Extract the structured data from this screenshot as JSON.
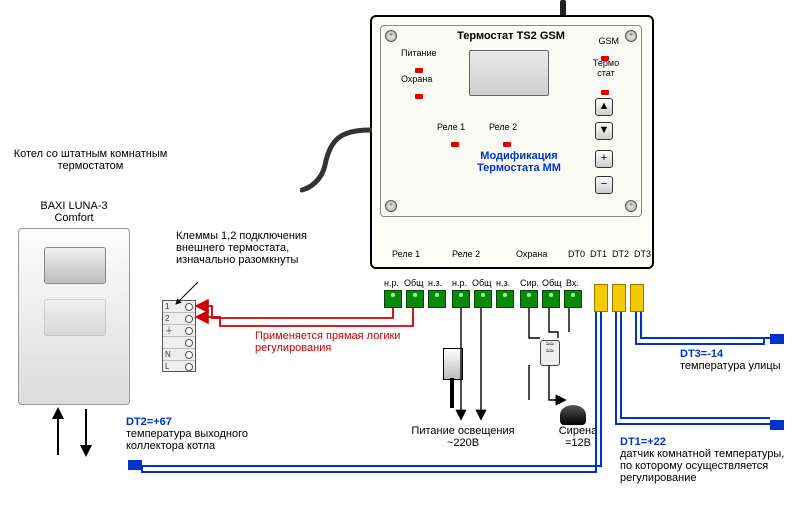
{
  "boiler": {
    "header": "Котел со штатным комнатным термостатом",
    "model": "BAXI LUNA-3 Comfort"
  },
  "terminals_note": "Клеммы 1,2 подключения внешнего термостата, изначально разомкнуты",
  "terminals": {
    "rows": [
      "1",
      "2",
      "⏚",
      "",
      "N",
      "L"
    ]
  },
  "logic_note": "Применяется прямая логики регулирования",
  "device": {
    "title": "Термостат TS2 GSM",
    "modification": "Модификация Термостата  MM",
    "labels": {
      "power": "Питание",
      "guard": "Охрана",
      "gsm": "GSM",
      "thermo_small": "Термо стат",
      "relay1": "Реле 1",
      "relay2": "Реле 2"
    },
    "buttons": {
      "up": "▲",
      "down": "▼",
      "plus": "+",
      "minus": "−"
    },
    "bottom": {
      "relay1": "Реле 1",
      "relay2": "Реле 2",
      "guard": "Охрана",
      "dt0": "DT0",
      "dt1": "DT1",
      "dt2": "DT2",
      "dt3": "DT3"
    }
  },
  "connectors": {
    "relay1": {
      "a": "н.р.",
      "b": "Общ",
      "c": "н.з."
    },
    "relay2": {
      "a": "н.р.",
      "b": "Общ",
      "c": "н.з."
    },
    "guard": {
      "a": "Сир.",
      "b": "Общ",
      "c": "Вх."
    }
  },
  "icons": {
    "lamp_label": "Питание освещения ~220В",
    "siren_label": "Сирена =12В"
  },
  "sensors": {
    "dt1": {
      "title": "DT1=+22",
      "desc": "датчик комнатной температуры, по которому осуществляется регулирование"
    },
    "dt2": {
      "title": "DT2=+67",
      "desc": "температура выходного коллектора котла"
    },
    "dt3": {
      "title": "DT3=-14",
      "desc": "температура улицы"
    }
  }
}
